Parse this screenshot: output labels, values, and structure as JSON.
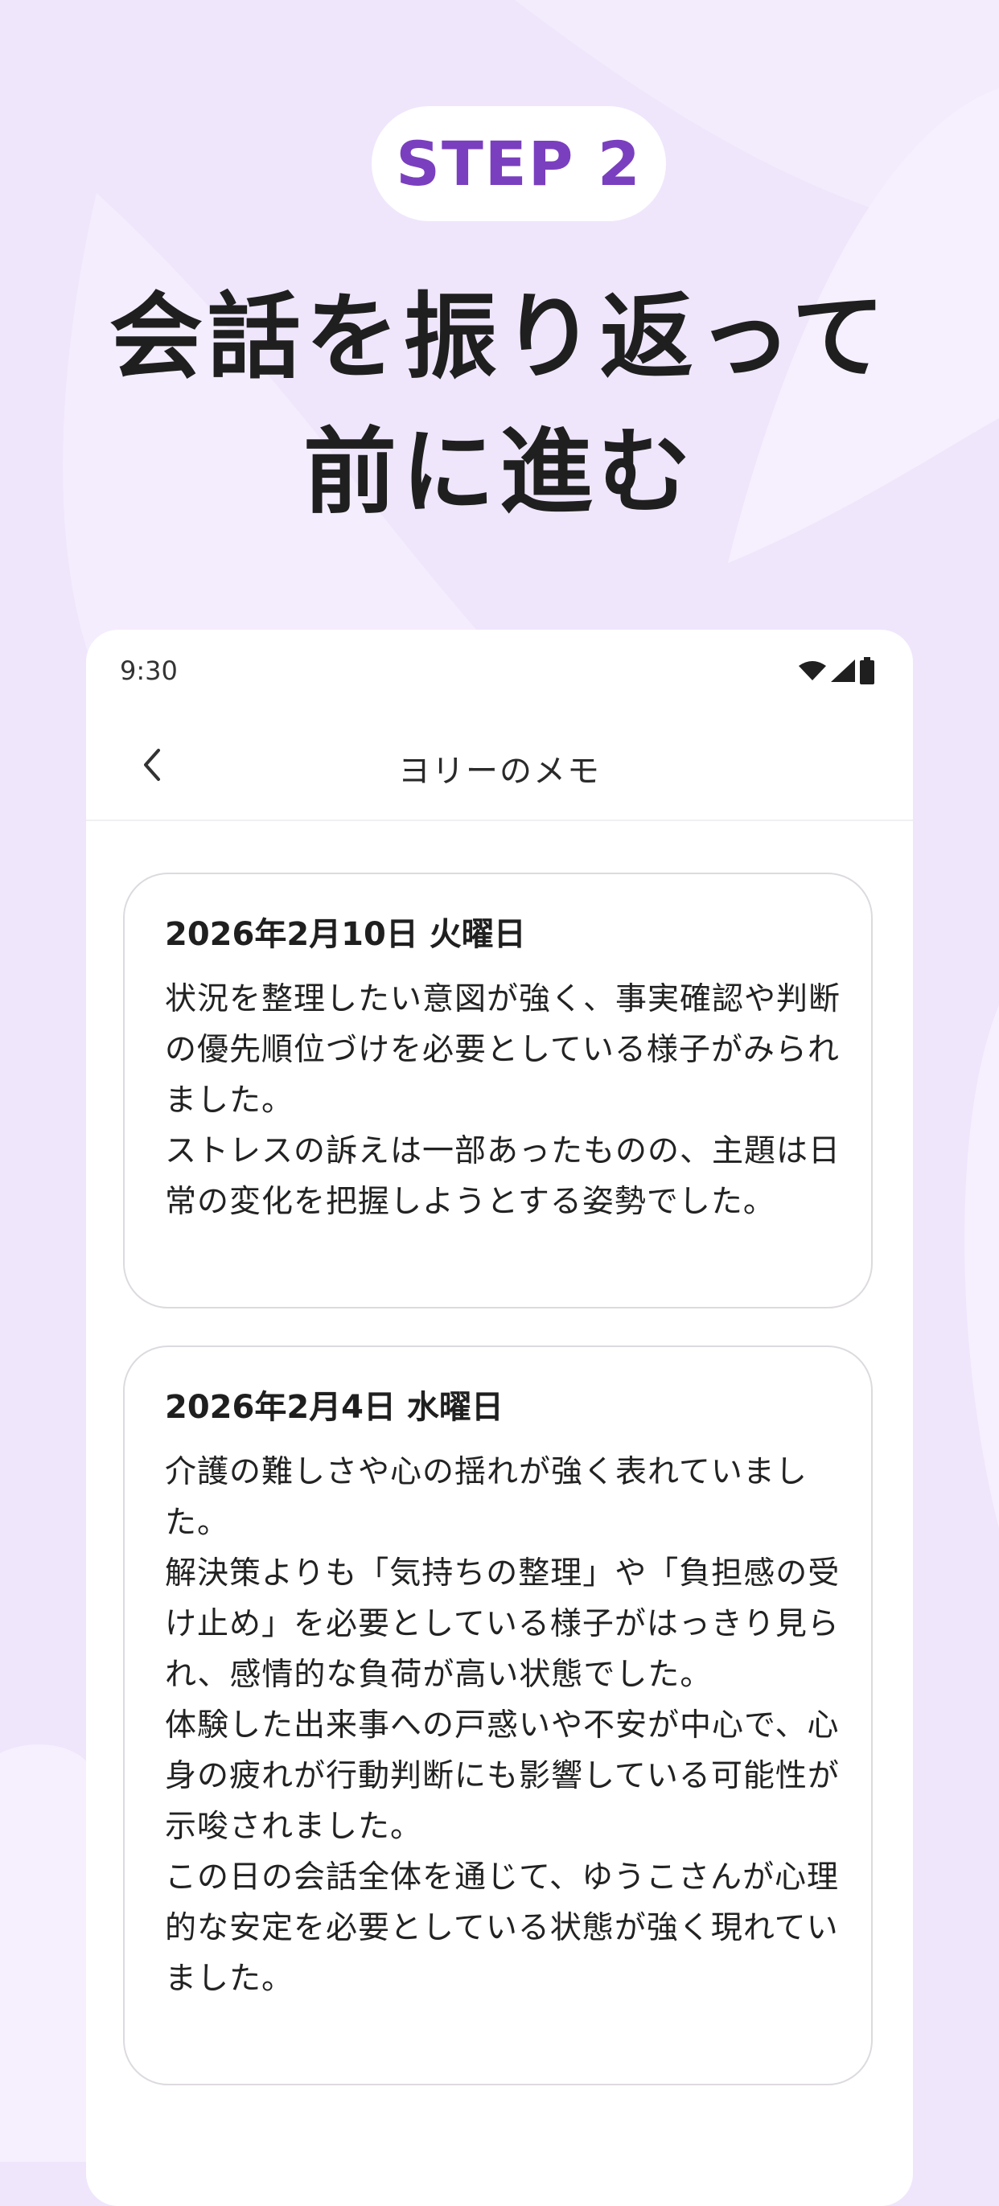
{
  "promo": {
    "step_label": "STEP 2",
    "headline_line1": "会話を振り返って",
    "headline_line2": "前に進む"
  },
  "status_bar": {
    "time": "9:30",
    "icons": [
      "wifi-icon",
      "cellular-signal-icon",
      "battery-icon"
    ]
  },
  "app_bar": {
    "back_icon": "chevron-left-icon",
    "title": "ヨリーのメモ"
  },
  "memos": [
    {
      "date": "2026年2月10日 火曜日",
      "body": "状況を整理したい意図が強く、事実確認や判断の優先順位づけを必要としている様子がみられました。\nストレスの訴えは一部あったものの、主題は日常の変化を把握しようとする姿勢でした。"
    },
    {
      "date": "2026年2月4日 水曜日",
      "body": "介護の難しさや心の揺れが強く表れていました。\n解決策よりも「気持ちの整理」や「負担感の受け止め」を必要としている様子がはっきり見られ、感情的な負荷が高い状態でした。\n体験した出来事への戸惑いや不安が中心で、心身の疲れが行動判断にも影響している可能性が示唆されました。\nこの日の会話全体を通じて、ゆうこさんが心理的な安定を必要としている状態が強く現れていました。"
    }
  ],
  "colors": {
    "background": "#efe6fc",
    "accent": "#7a3fbf",
    "card_border": "#dddadf"
  }
}
